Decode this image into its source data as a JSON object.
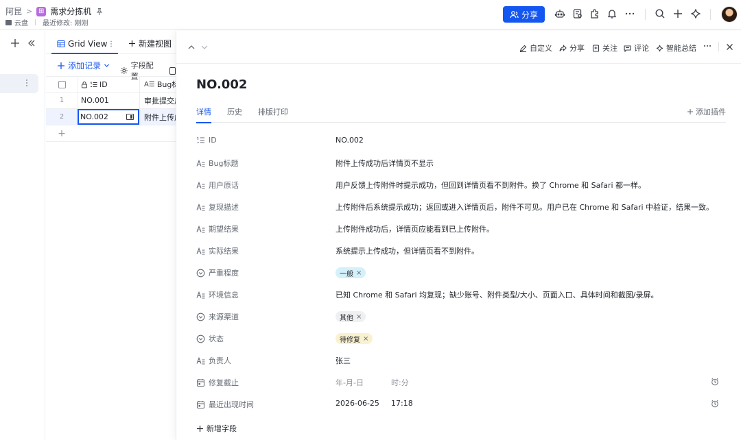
{
  "topbar": {
    "breadcrumb_root": "阿昆",
    "breadcrumb_sep": ">",
    "app_icon_glyph": "⊞",
    "doc_title": "需求分拣机",
    "location": "云盘",
    "last_modified": "最近修改: 刚刚",
    "share_label": "分享",
    "icons": [
      "robot-icon",
      "form-icon",
      "plugin-icon",
      "bell-icon",
      "more-icon",
      "search-icon",
      "plus-icon",
      "ai-sparkle-icon"
    ]
  },
  "grid": {
    "view_tab": "Grid View",
    "new_view": "新建视图",
    "add_record": "添加记录",
    "field_config": "字段配置",
    "columns": [
      "ID",
      "Bug标题"
    ],
    "rows": [
      {
        "index": "1",
        "id": "NO.001",
        "title": "审批提交后"
      },
      {
        "index": "2",
        "id": "NO.002",
        "title": "附件上传成功"
      }
    ],
    "add_row": "+"
  },
  "detail": {
    "actions": [
      "自定义",
      "分享",
      "关注",
      "评论",
      "智能总结"
    ],
    "title": "NO.002",
    "tabs": [
      "详情",
      "历史",
      "排版打印"
    ],
    "add_plugin": "添加插件",
    "fields": [
      {
        "label": "ID",
        "value": "NO.002",
        "icon": "autonumber-icon"
      },
      {
        "label": "Bug标题",
        "value": "附件上传成功后详情页不显示",
        "icon": "text-icon"
      },
      {
        "label": "用户原话",
        "value": "用户反馈上传附件时提示成功，但回到详情页看不到附件。换了 Chrome 和 Safari 都一样。",
        "icon": "text-icon"
      },
      {
        "label": "复现描述",
        "value": "上传附件后系统提示成功；返回或进入详情页后，附件不可见。用户已在 Chrome 和 Safari 中验证，结果一致。",
        "icon": "text-icon"
      },
      {
        "label": "期望结果",
        "value": "上传附件成功后，详情页应能看到已上传附件。",
        "icon": "text-icon"
      },
      {
        "label": "实际结果",
        "value": "系统提示上传成功，但详情页看不到附件。",
        "icon": "text-icon"
      },
      {
        "label": "严重程度",
        "tag": "一般",
        "tag_bg": "#d4f0fb",
        "icon": "select-icon"
      },
      {
        "label": "环境信息",
        "value": "已知 Chrome 和 Safari 均复现；缺少账号、附件类型/大小、页面入口、具体时间和截图/录屏。",
        "icon": "text-icon"
      },
      {
        "label": "来源渠道",
        "tag": "其他",
        "tag_bg": "#eff0f1",
        "icon": "select-icon"
      },
      {
        "label": "状态",
        "tag": "待修复",
        "tag_bg": "#faf1d1",
        "icon": "select-icon"
      },
      {
        "label": "负责人",
        "value": "张三",
        "icon": "text-icon"
      },
      {
        "label": "修复截止",
        "date": "年-月-日",
        "time": "时:分",
        "empty": true,
        "icon": "date-icon"
      },
      {
        "label": "最近出现时间",
        "date": "2026-06-25",
        "time": "17:18",
        "empty": false,
        "icon": "date-icon"
      }
    ],
    "add_field": "新增字段"
  },
  "colors": {
    "accent": "#1456f0",
    "app_icon": "#b86ae0",
    "selection": "#eef3ff"
  }
}
